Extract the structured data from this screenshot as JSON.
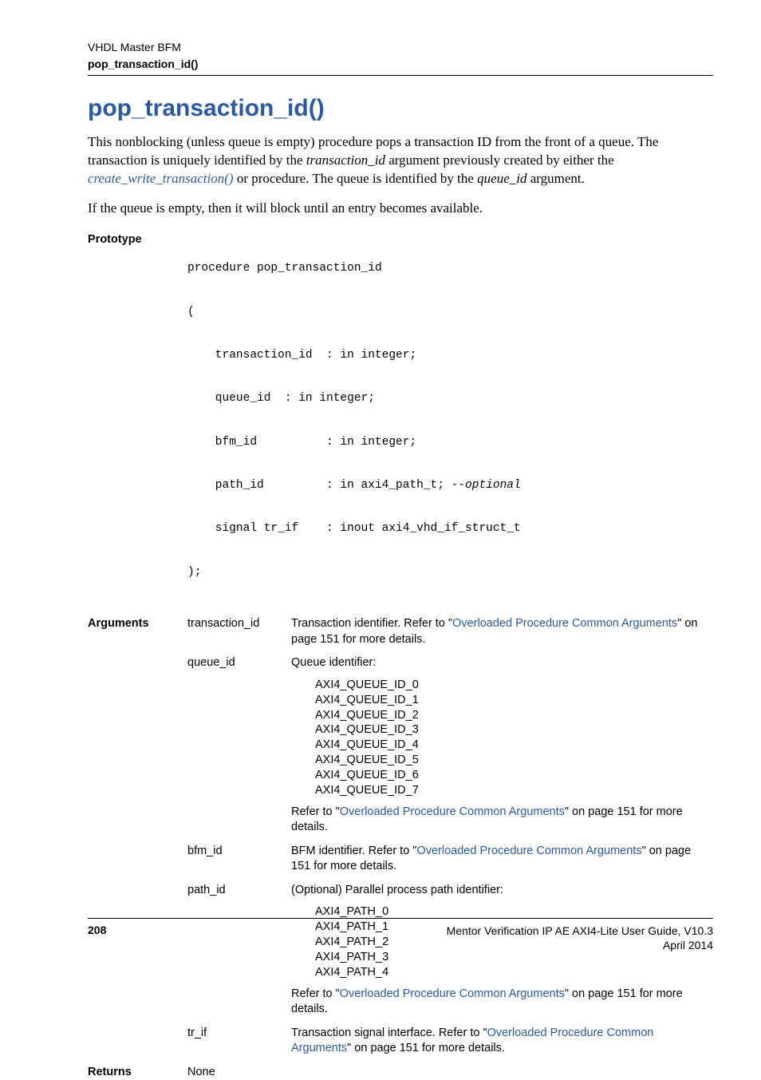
{
  "header": {
    "section": "VHDL Master BFM",
    "topic": "pop_transaction_id()"
  },
  "title": "pop_transaction_id()",
  "para1_pre": "This nonblocking (unless queue is empty) procedure pops a transaction ID from the front of a queue. The transaction is uniquely identified by the ",
  "para1_arg": "transaction_id",
  "para1_mid": " argument previously created by either the ",
  "para1_link": "create_write_transaction()",
  "para1_post1": " or  procedure. The queue is identified by the ",
  "para1_arg2": "queue_id",
  "para1_post2": " argument.",
  "para2": "If the queue is empty, then it will block until an entry becomes available.",
  "labels": {
    "prototype": "Prototype",
    "arguments": "Arguments",
    "returns": "Returns"
  },
  "prototype": {
    "l1": "procedure pop_transaction_id",
    "l2": "(",
    "l3": "    transaction_id  : in integer;",
    "l4": "    queue_id  : in integer;",
    "l5": "    bfm_id          : in integer;",
    "l6a": "    path_id         : in axi4_path_t; ",
    "l6b": "--optional",
    "l7": "    signal tr_if    : inout axi4_vhd_if_struct_t",
    "l8": ");"
  },
  "args": {
    "transaction_id": {
      "name": "transaction_id",
      "d1": "Transaction identifier. Refer to \"",
      "d_link": "Overloaded Procedure Common Arguments",
      "d2": "\" on page 151 for more details."
    },
    "queue_id": {
      "name": "queue_id",
      "intro": "Queue identifier:",
      "list": "AXI4_QUEUE_ID_0\nAXI4_QUEUE_ID_1\nAXI4_QUEUE_ID_2\nAXI4_QUEUE_ID_3\nAXI4_QUEUE_ID_4\nAXI4_QUEUE_ID_5\nAXI4_QUEUE_ID_6\nAXI4_QUEUE_ID_7",
      "r1": "Refer to \"",
      "r_link": "Overloaded Procedure Common Arguments",
      "r2": "\" on page 151 for more details."
    },
    "bfm_id": {
      "name": "bfm_id",
      "d1": "BFM identifier. Refer to \"",
      "d_link": "Overloaded Procedure Common Arguments",
      "d2": "\" on page 151 for more details."
    },
    "path_id": {
      "name": "path_id",
      "intro": "(Optional) Parallel process path identifier:",
      "list": "AXI4_PATH_0\nAXI4_PATH_1\nAXI4_PATH_2\nAXI4_PATH_3\nAXI4_PATH_4",
      "r1": "Refer to \"",
      "r_link": "Overloaded Procedure Common Arguments",
      "r2": "\" on page 151 for more details."
    },
    "tr_if": {
      "name": "tr_if",
      "d1": "Transaction signal interface. Refer to \"",
      "d_link": "Overloaded Procedure Common Arguments",
      "d2": "\" on page 151 for more details."
    }
  },
  "returns_value": "None",
  "footer": {
    "page": "208",
    "doc": "Mentor Verification IP AE AXI4-Lite User Guide, V10.3",
    "date": "April 2014"
  }
}
